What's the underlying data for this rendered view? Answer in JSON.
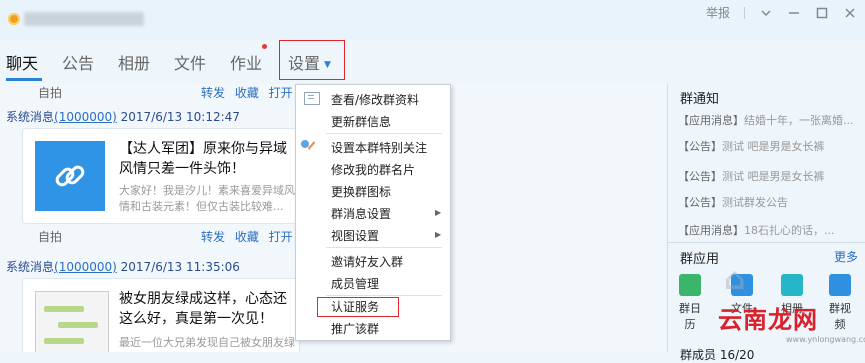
{
  "titlebar": {
    "report_label": "举报",
    "icons": [
      "more-icon",
      "minimize-icon",
      "maximize-icon",
      "close-icon"
    ]
  },
  "tabs": [
    {
      "label": "聊天"
    },
    {
      "label": "公告"
    },
    {
      "label": "相册"
    },
    {
      "label": "文件"
    },
    {
      "label": "作业"
    },
    {
      "label": "设置"
    }
  ],
  "chat": {
    "top_row": {
      "left": "自拍",
      "right": "转发 收藏 打开"
    },
    "messages": [
      {
        "sender": "系统消息",
        "uid": "(1000000)",
        "time": "2017/6/13 10:12:47",
        "title": "【达人军团】原来你与异域风情只差一件头饰！",
        "desc": "大家好！我是汐儿！素来喜爱异域风情和古装元素！但仅古装比较难...",
        "footer_left": "自拍",
        "footer_right": "转发 收藏 打开"
      },
      {
        "sender": "系统消息",
        "uid": "(1000000)",
        "time": "2017/6/13 11:35:06",
        "title": "被女朋友绿成这样，心态还这么好，真是第一次见！",
        "desc": "最近一位大兄弟发现自己被女朋友绿了"
      }
    ]
  },
  "menu": {
    "items": [
      "查看/修改群资料",
      "更新群信息",
      "设置本群特别关注",
      "修改我的群名片",
      "更换群图标",
      "群消息设置",
      "视图设置",
      "邀请好友入群",
      "成员管理",
      "认证服务",
      "推广该群"
    ]
  },
  "right_panel": {
    "notice_title": "群通知",
    "notices": [
      {
        "tag": "【应用消息】",
        "text": "结婚十年，一张离婚..."
      },
      {
        "tag": "【公告】",
        "text": "测试 吧是男是女长裤"
      },
      {
        "tag": "【公告】",
        "text": "测试 吧是男是女长裤"
      },
      {
        "tag": "【公告】",
        "text": "测试群发公告"
      },
      {
        "tag": "【应用消息】",
        "text": "18石扎心的话，..."
      }
    ],
    "apps_title": "群应用",
    "more": "更多",
    "apps": [
      {
        "label": "群日历",
        "color": "#3bb56a"
      },
      {
        "label": "文件",
        "color": "#2f8fe0"
      },
      {
        "label": "相册",
        "color": "#26b6c8"
      },
      {
        "label": "群视频",
        "color": "#2f8fe0"
      }
    ],
    "members": "群成员 16/20"
  },
  "watermark": {
    "text": "云南龙网",
    "url": "www.ynlongwang.com"
  },
  "colors": {
    "accent": "#2c7fd6",
    "highlight": "#e2262c"
  }
}
